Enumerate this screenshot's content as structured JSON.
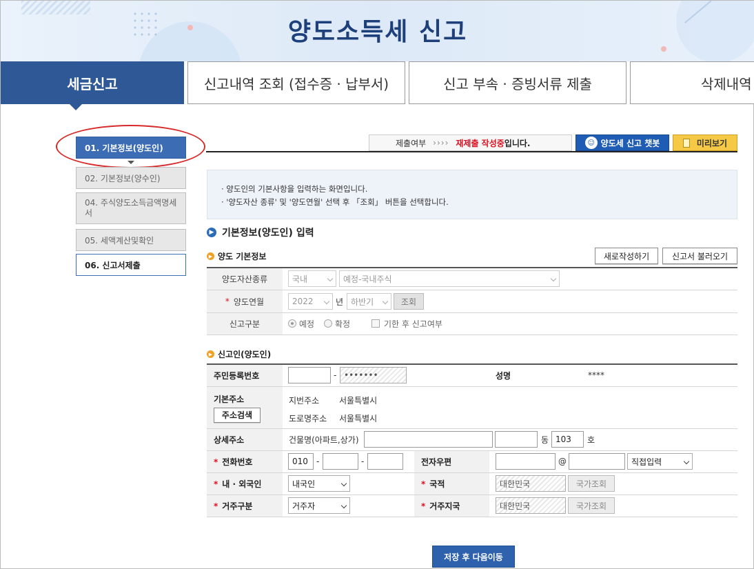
{
  "page_title": "양도소득세 신고",
  "tabs": [
    {
      "label": "세금신고"
    },
    {
      "label": "신고내역 조회 (접수증 · 납부서)"
    },
    {
      "label": "신고 부속 · 증빙서류 제출"
    },
    {
      "label": "삭제내역"
    }
  ],
  "sidebar": {
    "items": [
      {
        "label": "01. 기본정보(양도인)"
      },
      {
        "label": "02. 기본정보(양수인)"
      },
      {
        "label": "04. 주식양도소득금액명세서"
      },
      {
        "label": "05. 세액계산및확인"
      },
      {
        "label": "06. 신고서제출"
      }
    ]
  },
  "status": {
    "label": "제출여부",
    "arrows": "››››",
    "value_red": "재제출 작성중",
    "value_suffix": "입니다."
  },
  "buttons": {
    "chatbot": "양도세 신고 챗봇",
    "preview": "미리보기",
    "new_write": "새로작성하기",
    "load_report": "신고서 불러오기",
    "lookup": "조회",
    "address_search": "주소검색",
    "country_lookup_1": "국가조회",
    "country_lookup_2": "국가조회",
    "save_next": "저장 후 다음이동"
  },
  "info": {
    "line1": "· 양도인의 기본사항을 입력하는 화면입니다.",
    "line2": "· '양도자산 종류' 및 '양도연월' 선택 후 「조회」 버튼을 선택합니다."
  },
  "section_title": "기본정보(양도인) 입력",
  "transfer_info": {
    "title": "양도 기본정보",
    "asset_type_label": "양도자산종류",
    "asset_domestic": "국내",
    "asset_kind": "예정-국내주식",
    "period_label": "양도연월",
    "year": "2022",
    "year_unit": "년",
    "half": "하반기",
    "report_type_label": "신고구분",
    "radio_planned": "예정",
    "radio_final": "확정",
    "checkbox_late": "기한 후 신고여부"
  },
  "reporter": {
    "title": "신고인(양도인)",
    "rrn_label": "주민등록번호",
    "rrn_dash": "-",
    "rrn_back": "•••••••",
    "name_label": "성명",
    "name_value": "****",
    "address_label": "기본주소",
    "lot_address_label": "지번주소",
    "lot_address_value": "서울특별시",
    "road_address_label": "도로명주소",
    "road_address_value": "서울특별시",
    "detail_label": "상세주소",
    "building_label": "건물명(아파트,상가)",
    "dong_unit": "동",
    "ho_value": "103",
    "ho_unit": "호",
    "phone_label": "전화번호",
    "phone1": "010",
    "phone_dash1": "-",
    "phone_dash2": "-",
    "email_label": "전자우편",
    "email_at": "@",
    "email_domain_select": "직접입력",
    "nationality_type_label": "내 · 외국인",
    "nationality_type_value": "내국인",
    "nationality_label": "국적",
    "nationality_value": "대한민국",
    "residency_label": "거주구분",
    "residency_value": "거주자",
    "residence_country_label": "거주지국",
    "residence_country_value": "대한민국"
  },
  "colors": {
    "primary": "#2e5896",
    "required": "#dd1122",
    "highlight_circle": "#d82a2a"
  }
}
